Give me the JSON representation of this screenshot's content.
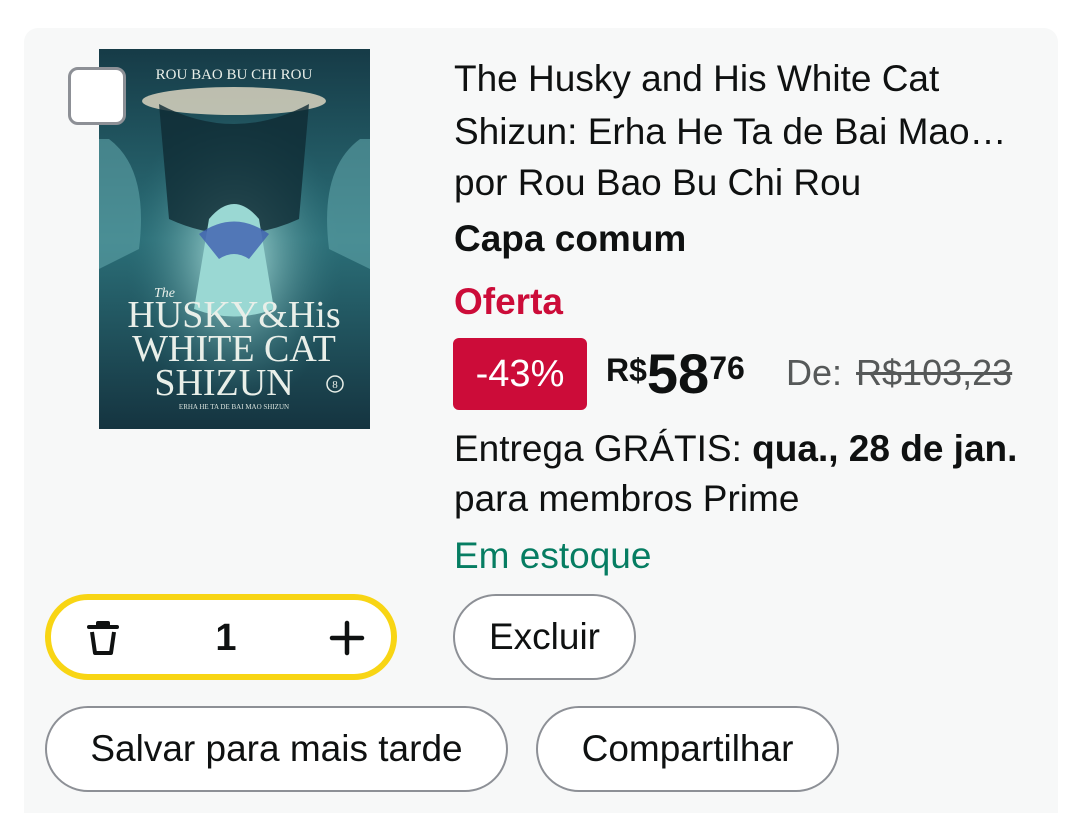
{
  "product": {
    "title_line1": "The Husky and His White Cat",
    "title_line2": "Shizun: Erha He Ta de Bai Mao…",
    "author": "por Rou Bao Bu Chi Rou",
    "format": "Capa comum",
    "deal_label": "Oferta",
    "discount": "-43%",
    "price_currency": "R$",
    "price_whole": "58",
    "price_fraction": "76",
    "was_label": "De:",
    "was_price": "R$103,23",
    "delivery_prefix": "Entrega GRÁTIS: ",
    "delivery_date": "qua., 28 de jan.",
    "delivery_suffix": " para membros Prime",
    "stock": "Em estoque"
  },
  "cover": {
    "author_text": "ROU BAO BU CHI ROU",
    "title_the": "The",
    "title_husky": "HUSKY&His",
    "title_white_cat": "WHITE CAT",
    "title_shizun": "SHIZUN",
    "volume": "8",
    "subtitle": "ERHA HE TA DE BAI MAO SHIZUN"
  },
  "cart": {
    "quantity": "1",
    "delete_icon": "trash-icon",
    "increase_icon": "plus-icon"
  },
  "actions": {
    "delete_label": "Excluir",
    "save_label": "Salvar para mais tarde",
    "share_label": "Compartilhar"
  },
  "colors": {
    "deal_red": "#cc0c39",
    "stock_green": "#067d62",
    "stepper_yellow": "#f8d514"
  }
}
